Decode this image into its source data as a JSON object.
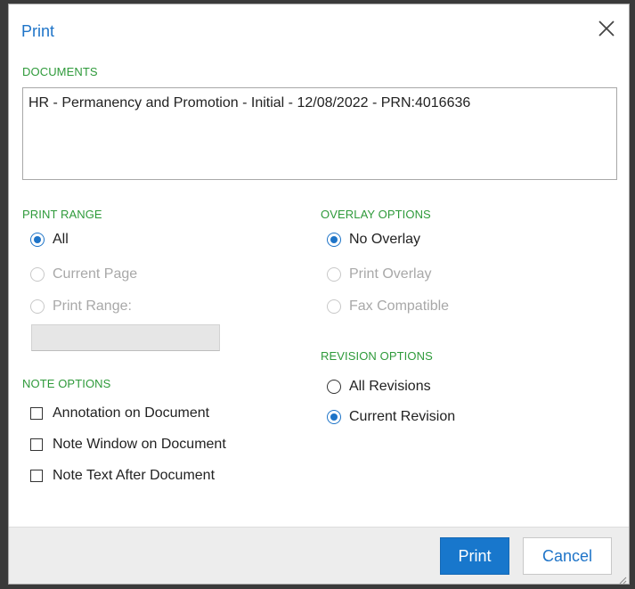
{
  "dialog": {
    "title": "Print",
    "close_icon": "close-icon"
  },
  "documents": {
    "label": "DOCUMENTS",
    "items": [
      "HR - Permanency and Promotion - Initial - 12/08/2022 - PRN:4016636"
    ]
  },
  "print_range": {
    "label": "PRINT RANGE",
    "options": [
      {
        "label": "All",
        "checked": true,
        "disabled": false
      },
      {
        "label": "Current Page",
        "checked": false,
        "disabled": true
      },
      {
        "label": "Print Range:",
        "checked": false,
        "disabled": true
      }
    ],
    "range_value": ""
  },
  "overlay_options": {
    "label": "OVERLAY OPTIONS",
    "options": [
      {
        "label": "No Overlay",
        "checked": true,
        "disabled": false
      },
      {
        "label": "Print Overlay",
        "checked": false,
        "disabled": true
      },
      {
        "label": "Fax Compatible",
        "checked": false,
        "disabled": true
      }
    ]
  },
  "revision_options": {
    "label": "REVISION OPTIONS",
    "options": [
      {
        "label": "All Revisions",
        "checked": false,
        "disabled": false
      },
      {
        "label": "Current Revision",
        "checked": true,
        "disabled": false
      }
    ]
  },
  "note_options": {
    "label": "NOTE OPTIONS",
    "options": [
      {
        "label": "Annotation on Document",
        "checked": false
      },
      {
        "label": "Note Window on Document",
        "checked": false
      },
      {
        "label": "Note Text After Document",
        "checked": false
      }
    ]
  },
  "footer": {
    "print_label": "Print",
    "cancel_label": "Cancel"
  },
  "colors": {
    "accent": "#1e74c8",
    "section_label": "#2e9a3a",
    "disabled_text": "#a8a8a8"
  }
}
